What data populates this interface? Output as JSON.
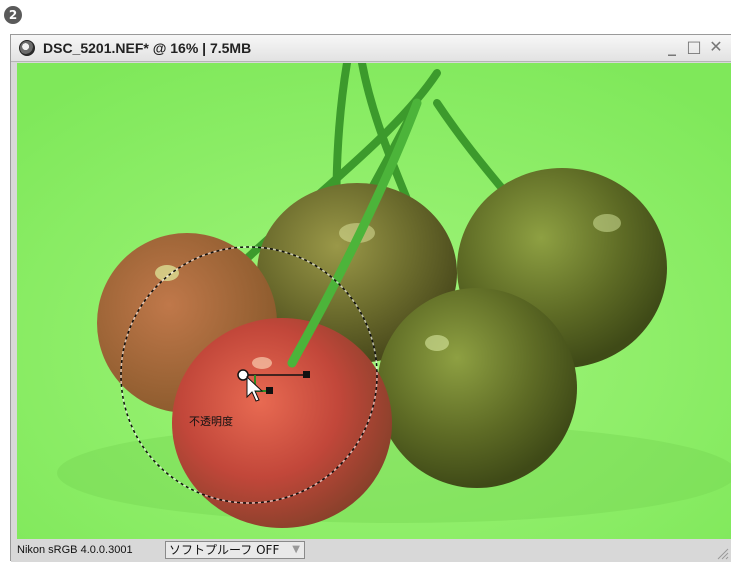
{
  "step_badge": "2",
  "window": {
    "title": "DSC_5201.NEF* @ 16% | 7.5MB",
    "controls": {
      "minimize": "_",
      "maximize": "□",
      "close": "✕"
    }
  },
  "canvas": {
    "overlay_label": "不透明度",
    "mask_color": "#8ef068"
  },
  "statusbar": {
    "profile": "Nikon sRGB 4.0.0.3001",
    "softproof": "ソフトプルーフ OFF",
    "softproof_arrow": "▼"
  }
}
